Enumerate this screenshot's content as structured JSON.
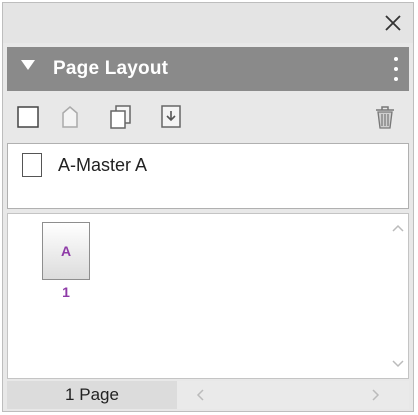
{
  "panel": {
    "title": "Page Layout"
  },
  "toolbar": {
    "icons": [
      "new-page-icon",
      "new-master-icon",
      "duplicate-icon",
      "move-page-icon",
      "trash-icon"
    ]
  },
  "masters": {
    "items": [
      {
        "label": "A-Master A"
      }
    ]
  },
  "pages": {
    "items": [
      {
        "prefix": "A",
        "number": "1"
      }
    ]
  },
  "status": {
    "text": "1 Page"
  },
  "colors": {
    "header_bg": "#8a8a8a",
    "page_label": "#8e3aa7",
    "panel_bg": "#e8e8e8"
  }
}
